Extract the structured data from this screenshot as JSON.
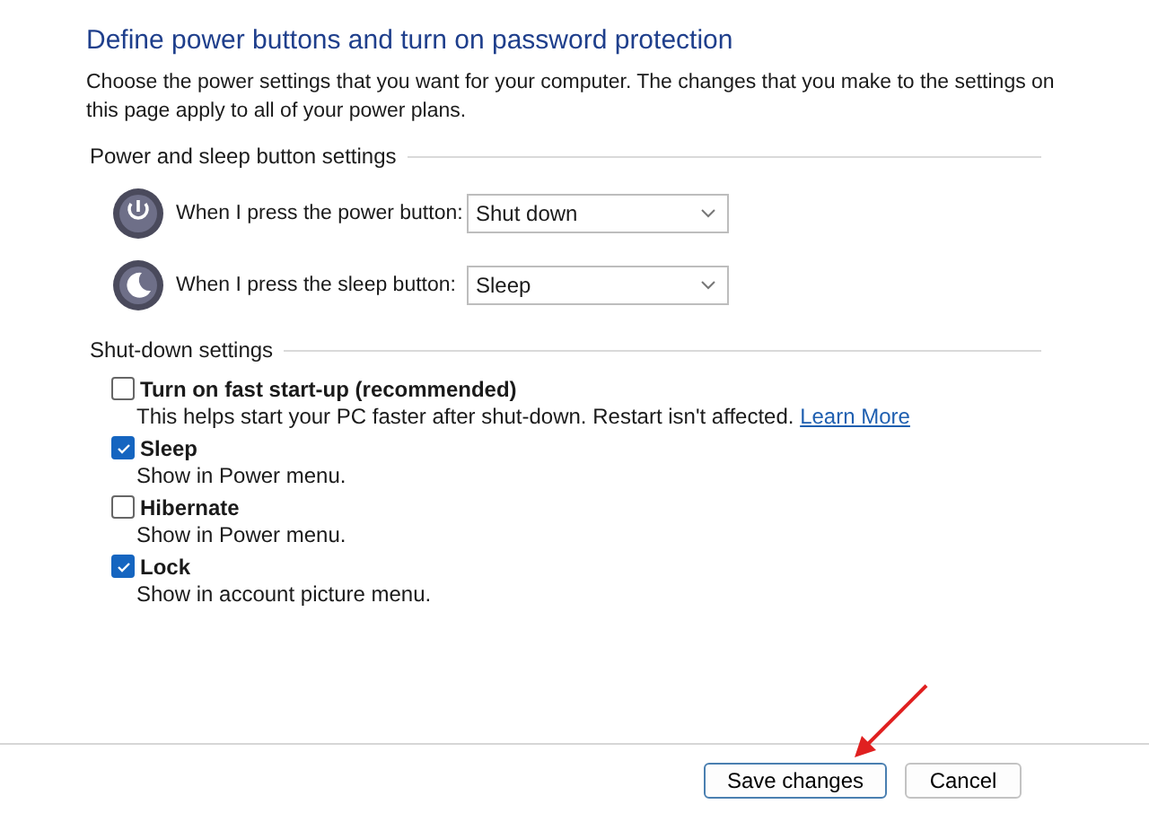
{
  "title": "Define power buttons and turn on password protection",
  "description": "Choose the power settings that you want for your computer. The changes that you make to the settings on this page apply to all of your power plans.",
  "button_section": {
    "heading": "Power and sleep button settings",
    "rows": [
      {
        "kind": "power",
        "label": "When I press the power button:",
        "value": "Shut down"
      },
      {
        "kind": "sleep",
        "label": "When I press the sleep button:",
        "value": "Sleep"
      }
    ]
  },
  "shutdown_section": {
    "heading": "Shut-down settings",
    "options": [
      {
        "label": "Turn on fast start-up (recommended)",
        "checked": false,
        "description": "This helps start your PC faster after shut-down. Restart isn't affected.",
        "link": "Learn More"
      },
      {
        "label": "Sleep",
        "checked": true,
        "description": "Show in Power menu."
      },
      {
        "label": "Hibernate",
        "checked": false,
        "description": "Show in Power menu."
      },
      {
        "label": "Lock",
        "checked": true,
        "description": "Show in account picture menu."
      }
    ]
  },
  "buttons": [
    {
      "label": "Save changes",
      "kind": "primary"
    },
    {
      "label": "Cancel",
      "kind": "secondary"
    }
  ]
}
